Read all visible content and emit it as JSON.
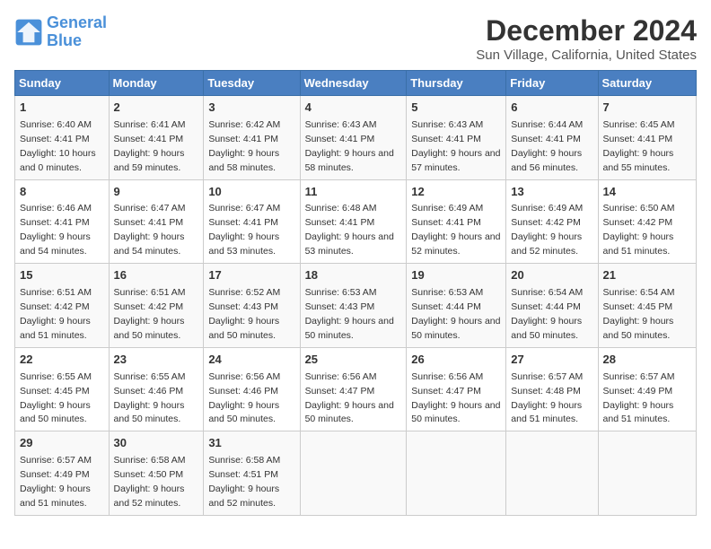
{
  "logo": {
    "line1": "General",
    "line2": "Blue"
  },
  "title": "December 2024",
  "subtitle": "Sun Village, California, United States",
  "days_of_week": [
    "Sunday",
    "Monday",
    "Tuesday",
    "Wednesday",
    "Thursday",
    "Friday",
    "Saturday"
  ],
  "weeks": [
    [
      {
        "day": "1",
        "sunrise": "6:40 AM",
        "sunset": "4:41 PM",
        "daylight": "10 hours and 0 minutes."
      },
      {
        "day": "2",
        "sunrise": "6:41 AM",
        "sunset": "4:41 PM",
        "daylight": "9 hours and 59 minutes."
      },
      {
        "day": "3",
        "sunrise": "6:42 AM",
        "sunset": "4:41 PM",
        "daylight": "9 hours and 58 minutes."
      },
      {
        "day": "4",
        "sunrise": "6:43 AM",
        "sunset": "4:41 PM",
        "daylight": "9 hours and 58 minutes."
      },
      {
        "day": "5",
        "sunrise": "6:43 AM",
        "sunset": "4:41 PM",
        "daylight": "9 hours and 57 minutes."
      },
      {
        "day": "6",
        "sunrise": "6:44 AM",
        "sunset": "4:41 PM",
        "daylight": "9 hours and 56 minutes."
      },
      {
        "day": "7",
        "sunrise": "6:45 AM",
        "sunset": "4:41 PM",
        "daylight": "9 hours and 55 minutes."
      }
    ],
    [
      {
        "day": "8",
        "sunrise": "6:46 AM",
        "sunset": "4:41 PM",
        "daylight": "9 hours and 54 minutes."
      },
      {
        "day": "9",
        "sunrise": "6:47 AM",
        "sunset": "4:41 PM",
        "daylight": "9 hours and 54 minutes."
      },
      {
        "day": "10",
        "sunrise": "6:47 AM",
        "sunset": "4:41 PM",
        "daylight": "9 hours and 53 minutes."
      },
      {
        "day": "11",
        "sunrise": "6:48 AM",
        "sunset": "4:41 PM",
        "daylight": "9 hours and 53 minutes."
      },
      {
        "day": "12",
        "sunrise": "6:49 AM",
        "sunset": "4:41 PM",
        "daylight": "9 hours and 52 minutes."
      },
      {
        "day": "13",
        "sunrise": "6:49 AM",
        "sunset": "4:42 PM",
        "daylight": "9 hours and 52 minutes."
      },
      {
        "day": "14",
        "sunrise": "6:50 AM",
        "sunset": "4:42 PM",
        "daylight": "9 hours and 51 minutes."
      }
    ],
    [
      {
        "day": "15",
        "sunrise": "6:51 AM",
        "sunset": "4:42 PM",
        "daylight": "9 hours and 51 minutes."
      },
      {
        "day": "16",
        "sunrise": "6:51 AM",
        "sunset": "4:42 PM",
        "daylight": "9 hours and 50 minutes."
      },
      {
        "day": "17",
        "sunrise": "6:52 AM",
        "sunset": "4:43 PM",
        "daylight": "9 hours and 50 minutes."
      },
      {
        "day": "18",
        "sunrise": "6:53 AM",
        "sunset": "4:43 PM",
        "daylight": "9 hours and 50 minutes."
      },
      {
        "day": "19",
        "sunrise": "6:53 AM",
        "sunset": "4:44 PM",
        "daylight": "9 hours and 50 minutes."
      },
      {
        "day": "20",
        "sunrise": "6:54 AM",
        "sunset": "4:44 PM",
        "daylight": "9 hours and 50 minutes."
      },
      {
        "day": "21",
        "sunrise": "6:54 AM",
        "sunset": "4:45 PM",
        "daylight": "9 hours and 50 minutes."
      }
    ],
    [
      {
        "day": "22",
        "sunrise": "6:55 AM",
        "sunset": "4:45 PM",
        "daylight": "9 hours and 50 minutes."
      },
      {
        "day": "23",
        "sunrise": "6:55 AM",
        "sunset": "4:46 PM",
        "daylight": "9 hours and 50 minutes."
      },
      {
        "day": "24",
        "sunrise": "6:56 AM",
        "sunset": "4:46 PM",
        "daylight": "9 hours and 50 minutes."
      },
      {
        "day": "25",
        "sunrise": "6:56 AM",
        "sunset": "4:47 PM",
        "daylight": "9 hours and 50 minutes."
      },
      {
        "day": "26",
        "sunrise": "6:56 AM",
        "sunset": "4:47 PM",
        "daylight": "9 hours and 50 minutes."
      },
      {
        "day": "27",
        "sunrise": "6:57 AM",
        "sunset": "4:48 PM",
        "daylight": "9 hours and 51 minutes."
      },
      {
        "day": "28",
        "sunrise": "6:57 AM",
        "sunset": "4:49 PM",
        "daylight": "9 hours and 51 minutes."
      }
    ],
    [
      {
        "day": "29",
        "sunrise": "6:57 AM",
        "sunset": "4:49 PM",
        "daylight": "9 hours and 51 minutes."
      },
      {
        "day": "30",
        "sunrise": "6:58 AM",
        "sunset": "4:50 PM",
        "daylight": "9 hours and 52 minutes."
      },
      {
        "day": "31",
        "sunrise": "6:58 AM",
        "sunset": "4:51 PM",
        "daylight": "9 hours and 52 minutes."
      },
      null,
      null,
      null,
      null
    ]
  ]
}
